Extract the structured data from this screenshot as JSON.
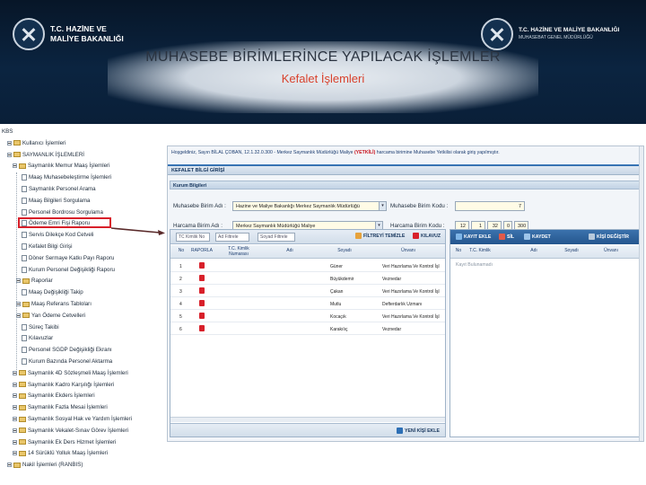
{
  "banner": {
    "ministry_line1": "T.C. HAZİNE VE",
    "ministry_line2": "MALİYE BAKANLIĞI",
    "ministry_right_line1": "T.C. HAZİNE VE MALİYE BAKANLIĞI",
    "ministry_right_line2": "MUHASEBAT GENEL MÜDÜRLÜĞÜ",
    "title": "MUHASEBE BİRİMLERİNCE YAPILACAK İŞLEMLER",
    "subtitle": "Kefalet İşlemleri"
  },
  "tree": {
    "items": [
      {
        "label": "KBS",
        "type": "root"
      },
      {
        "label": "Kullanıcı İşlemleri",
        "type": "folder"
      },
      {
        "label": "SAYMANLIK İŞLEMLERİ",
        "type": "folder"
      },
      {
        "label": "Saymanlık Memur Maaş İşlemleri",
        "type": "folder"
      },
      {
        "label": "Maaş Muhasebeleştirme İşlemleri",
        "type": "page"
      },
      {
        "label": "Saymanlık Personel Arama",
        "type": "page"
      },
      {
        "label": "Maaş Bilgileri Sorgulama",
        "type": "page"
      },
      {
        "label": "Personel Bordrosu Sorgulama",
        "type": "page"
      },
      {
        "label": "Ödeme Emri Fişi Raporu",
        "type": "page"
      },
      {
        "label": "Servis Dilekçe Kod Cetveli",
        "type": "page"
      },
      {
        "label": "Kefalet Bilgi Girişi",
        "type": "page"
      },
      {
        "label": "Döner Sermaye Katkı Payı Raporu",
        "type": "page"
      },
      {
        "label": "Kurum Personel Değişikliği Raporu",
        "type": "page"
      },
      {
        "label": "Raporlar",
        "type": "folder"
      },
      {
        "label": "Maaş Değişikliği Takip",
        "type": "page"
      },
      {
        "label": "Maaş Referans Tabloları",
        "type": "folder"
      },
      {
        "label": "Yan Ödeme Cetvelleri",
        "type": "folder"
      },
      {
        "label": "Süreç Takibi",
        "type": "page"
      },
      {
        "label": "Kılavuzlar",
        "type": "page"
      },
      {
        "label": "Personel SGDP Değişikliği Ekranı",
        "type": "page"
      },
      {
        "label": "Kurum Bazında Personel Aktarma",
        "type": "page"
      },
      {
        "label": "Saymanlık 4D Sözleşmeli Maaş İşlemleri",
        "type": "folder"
      },
      {
        "label": "Saymanlık Kadro Karşılığı İşlemleri",
        "type": "folder"
      },
      {
        "label": "Saymanlık Ekders İşlemleri",
        "type": "folder"
      },
      {
        "label": "Saymanlık Fazla Mesai İşlemleri",
        "type": "folder"
      },
      {
        "label": "Saymanlık Sosyal Hak ve Yardım İşlemleri",
        "type": "folder"
      },
      {
        "label": "Saymanlık Vekalet-Sınav Görev İşlemleri",
        "type": "folder"
      },
      {
        "label": "Saymanlık Ek Ders Hizmet İşlemleri",
        "type": "folder"
      },
      {
        "label": "14 Sürüklü Yolluk Maaş İşlemleri",
        "type": "folder"
      },
      {
        "label": "Nakil İşlemleri (RANBIS)",
        "type": "folder"
      }
    ]
  },
  "app": {
    "welcome_prefix": "Hoşgeldiniz, Sayın BİLAL ÇOBAN, 12.1.32.0.300 - Merkez Saymanlık Müdürlüğü Maliye ",
    "welcome_highlight": "(YETKİLİ)",
    "welcome_suffix": " harcama birimine Muhasebe Yetkilisi olarak giriş yapılmıştır.",
    "panel_title": "KEFALET BİLGİ GİRİŞİ",
    "section_title": "Kurum Bilgileri",
    "kurum_birim_adi_label": "Muhasebe Birim Adı :",
    "kurum_birim_adi_value": "Hazine ve Maliye Bakanlığı Merkez Saymanlık Müdürlüğü",
    "harcama_birim_adi_label": "Harcama Birim Adı :",
    "harcama_birim_adi_value": "Merkez Saymanlık Müdürlüğü Maliye",
    "muhasebe_birim_kodu_label": "Muhasebe Birim Kodu :",
    "muhasebe_birim_kodu_value": "7",
    "harcama_birim_kodu_label": "Harcama Birim Kodu :",
    "harcama_birim_kodu_values": [
      "12",
      "1",
      "32",
      "0",
      "300"
    ]
  },
  "left_grid": {
    "filters": [
      "TC Kimlik No",
      "Ad Filtrele",
      "Soyad Filtrele"
    ],
    "clear_filter_label": "FİLTREYİ TEMİZLE",
    "guide_label": "KILAVUZ",
    "columns": [
      "No",
      "RAPORLA",
      "T.C. Kimlik Numarası",
      "Adı",
      "Soyadı",
      "Ünvanı"
    ],
    "rows": [
      {
        "no": "1",
        "ad": "",
        "soyad": "Güner",
        "unvan": "Veri Hazırlama Ve Kontrol İşl"
      },
      {
        "no": "2",
        "ad": "",
        "soyad": "Büyükdemir",
        "unvan": "Veznedar"
      },
      {
        "no": "3",
        "ad": "",
        "soyad": "Çakan",
        "unvan": "Veri Hazırlama Ve Kontrol İşl"
      },
      {
        "no": "4",
        "ad": "",
        "soyad": "Mutlu",
        "unvan": "Defterdarlık Uzmanı"
      },
      {
        "no": "5",
        "ad": "",
        "soyad": "Kocaçık",
        "unvan": "Veri Hazırlama Ve Kontrol İşl"
      },
      {
        "no": "6",
        "ad": "",
        "soyad": "Karakılıç",
        "unvan": "Veznedar"
      }
    ],
    "new_person_label": "YENİ KİŞİ EKLE"
  },
  "right_grid": {
    "add_record_label": "KAYIT EKLE",
    "delete_label": "SİL",
    "save_label": "KAYDET",
    "change_person_label": "KİŞİ DEĞİŞTİR",
    "columns": [
      "No",
      "T.C. Kimlik",
      "Adı",
      "Soyadı",
      "Ünvanı"
    ],
    "empty_text": "Kayıt Bulunamadı"
  },
  "colors": {
    "banner_bg": "#0b2440",
    "title_color": "#2a3340",
    "subtitle_color": "#d8412c",
    "highlight_red": "#d8202a",
    "toolbar_blue": "#25568e"
  }
}
